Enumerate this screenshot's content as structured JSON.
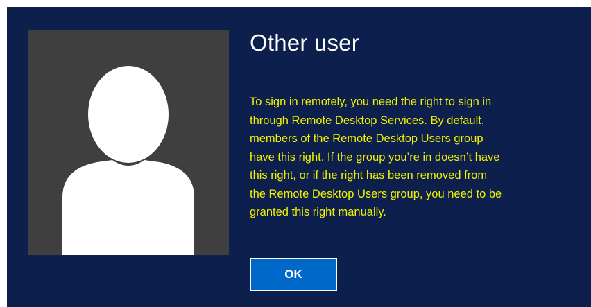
{
  "dialog": {
    "title": "Other user",
    "message_lines": [
      "To sign in remotely, you need the right to sign in",
      "through Remote Desktop Services. By default,",
      "members of the Remote Desktop Users group",
      "have this right. If the group you’re in doesn’t have",
      "this right, or if the right has been removed from",
      "the Remote Desktop Users group, you need to be",
      "granted this right manually."
    ],
    "ok_label": "OK"
  },
  "avatar": {
    "icon": "user-silhouette-icon"
  },
  "colors": {
    "background": "#0c1f4d",
    "avatar_tile": "#3f3f3f",
    "avatar_silhouette": "#ffffff",
    "title_text": "#ffffff",
    "message_text": "#f0f000",
    "button_fill": "#0068c8",
    "button_border": "#ffffff"
  }
}
